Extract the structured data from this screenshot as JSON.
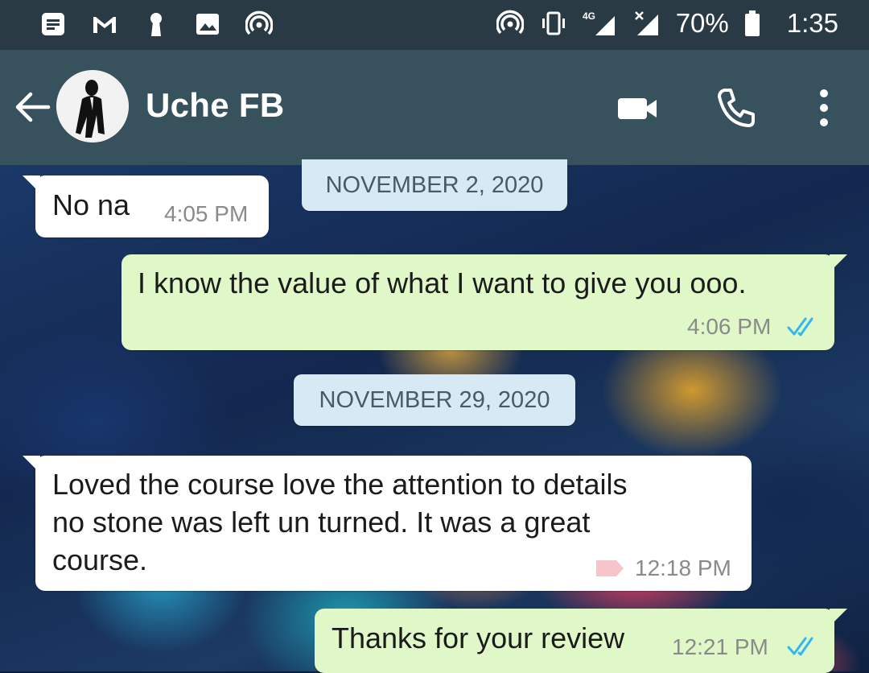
{
  "status_bar": {
    "network": "4G",
    "battery": "70%",
    "time": "1:35",
    "left_icons": [
      "notes-icon",
      "gmail-icon",
      "keyhole-icon",
      "image-icon",
      "hotspot-icon"
    ],
    "right_icons": [
      "hotspot-icon",
      "vibrate-icon",
      "signal-4g-icon",
      "signal-no-service-icon",
      "battery-icon"
    ]
  },
  "toolbar": {
    "contact_name": "Uche FB",
    "background": "#37515d",
    "actions": [
      "video-call-icon",
      "voice-call-icon",
      "more-options-icon"
    ]
  },
  "chat": {
    "messages": [
      {
        "direction": "in",
        "text": "No na",
        "time": "4:05 PM"
      },
      {
        "date": "NOVEMBER 2, 2020"
      },
      {
        "direction": "out",
        "text": "I know the value of what I want to give you ooo.",
        "time": "4:06 PM",
        "status": "read"
      },
      {
        "date": "NOVEMBER 29, 2020"
      },
      {
        "direction": "in",
        "text_lines": [
          "Loved the course love the attention to details",
          "no stone was left un turned. It was a great",
          "course."
        ],
        "time": "12:18 PM"
      },
      {
        "direction": "out",
        "text": "Thanks for your review",
        "time": "12:21 PM",
        "status": "read"
      }
    ],
    "incoming_bubble_color": "#ffffff",
    "outgoing_bubble_color": "#e0f8c8",
    "read_tick_color": "#34b7f1"
  }
}
